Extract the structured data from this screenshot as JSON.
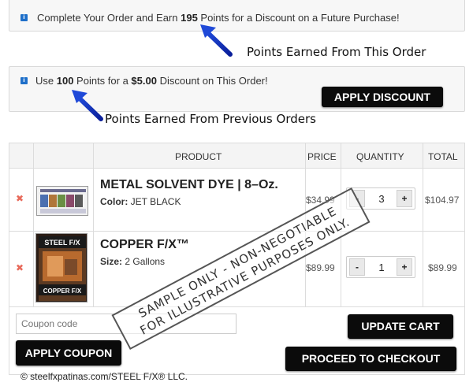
{
  "notices": {
    "earn": {
      "prefix": "Complete Your Order and Earn ",
      "points": "195",
      "suffix": " Points for a Discount on a Future Purchase!"
    },
    "use": {
      "prefix": "Use ",
      "points": "100",
      "mid": " Points for a ",
      "amount": "$5.00",
      "suffix": " Discount on This Order!"
    },
    "apply_discount_label": "APPLY DISCOUNT"
  },
  "annotations": {
    "earned_this_order": "Points Earned From This Order",
    "earned_previous": "Points Earned From Previous Orders"
  },
  "cart": {
    "headers": {
      "product": "PRODUCT",
      "price": "PRICE",
      "quantity": "QUANTITY",
      "total": "TOTAL"
    },
    "remove_glyph": "✖",
    "qty_minus": "-",
    "qty_plus": "+",
    "items": [
      {
        "name": "METAL SOLVENT DYE | 8–Oz.",
        "attr_label": "Color:",
        "attr_value": "JET BLACK",
        "price": "$34.99",
        "qty": "3",
        "total": "$104.97"
      },
      {
        "name": "COPPER F/X™",
        "attr_label": "Size:",
        "attr_value": "2 Gallons",
        "price": "$89.99",
        "qty": "1",
        "total": "$89.99"
      }
    ],
    "thumb2_text": {
      "top": "STEEL F/X",
      "bottom": "COPPER F/X"
    }
  },
  "coupon": {
    "placeholder": "Coupon code",
    "apply_label": "APPLY COUPON"
  },
  "actions": {
    "update_label": "UPDATE CART",
    "checkout_label": "PROCEED TO CHECKOUT"
  },
  "watermark": {
    "line1": "SAMPLE ONLY - NON-NEGOTIABLE",
    "line2": "FOR ILLUSTRATIVE PURPOSES ONLY."
  },
  "copyright": "© steelfxpatinas.com/STEEL F/X® LLC.",
  "colors": {
    "accent_blue": "#1e6fc9",
    "button_black": "#0b0b0b",
    "remove_red": "#e86a5b"
  }
}
